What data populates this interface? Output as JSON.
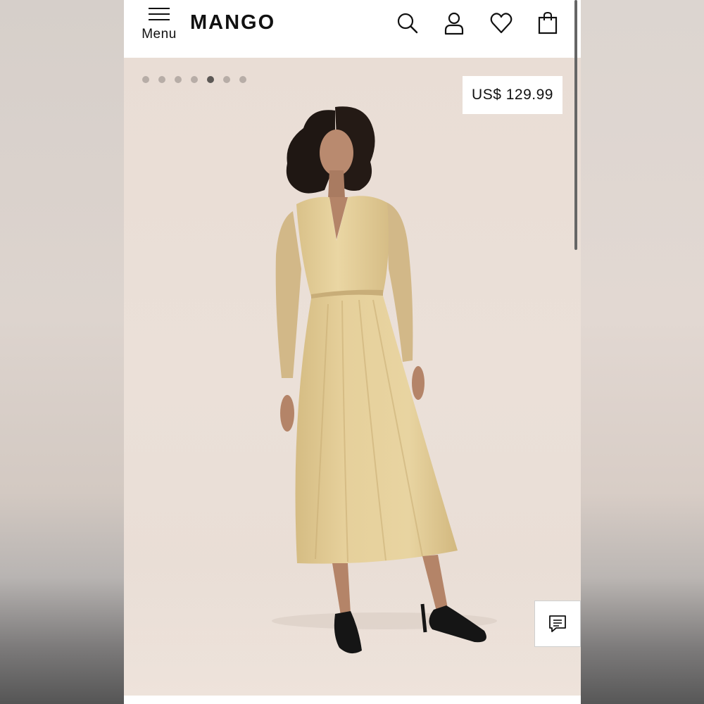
{
  "header": {
    "menu_label": "Menu",
    "logo": "MANGO",
    "icons": [
      "search-icon",
      "user-icon",
      "heart-icon",
      "bag-icon"
    ]
  },
  "carousel": {
    "total_slides": 7,
    "active_index": 4
  },
  "product": {
    "price": "US$ 129.99"
  },
  "chat": {
    "icon": "chat-icon"
  },
  "colors": {
    "header_bg": "#ffffff",
    "hero_bg": "#eadfd7",
    "dress": "#e2cc97",
    "dot_inactive": "#b7ada7",
    "dot_active": "#5c5855"
  }
}
